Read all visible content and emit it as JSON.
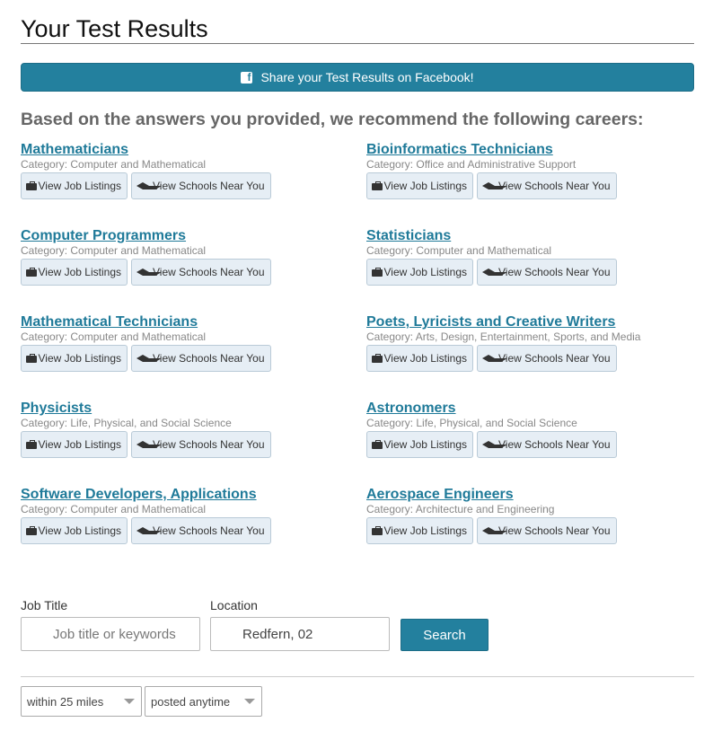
{
  "header": {
    "title": "Your Test Results",
    "share_label": "Share your Test Results on Facebook!"
  },
  "recommend_heading": "Based on the answers you provided, we recommend the following careers:",
  "buttons": {
    "jobs_label": "View Job Listings",
    "schools_label": "View Schools Near You"
  },
  "careers": [
    {
      "title": "Mathematicians",
      "category": "Category: Computer and Mathematical"
    },
    {
      "title": "Bioinformatics Technicians",
      "category": "Category: Office and Administrative Support"
    },
    {
      "title": "Computer Programmers",
      "category": "Category: Computer and Mathematical"
    },
    {
      "title": "Statisticians",
      "category": "Category: Computer and Mathematical"
    },
    {
      "title": "Mathematical Technicians",
      "category": "Category: Computer and Mathematical"
    },
    {
      "title": "Poets, Lyricists and Creative Writers",
      "category": "Category: Arts, Design, Entertainment, Sports, and Media"
    },
    {
      "title": "Physicists",
      "category": "Category: Life, Physical, and Social Science"
    },
    {
      "title": "Astronomers",
      "category": "Category: Life, Physical, and Social Science"
    },
    {
      "title": "Software Developers, Applications",
      "category": "Category: Computer and Mathematical"
    },
    {
      "title": "Aerospace Engineers",
      "category": "Category: Architecture and Engineering"
    }
  ],
  "search": {
    "job_title_label": "Job Title",
    "job_title_placeholder": "Job title or keywords",
    "location_label": "Location",
    "location_value": "Redfern, 02",
    "search_label": "Search",
    "distance_selected": "within 25 miles",
    "posted_selected": "posted anytime"
  },
  "colors": {
    "accent": "#23809e",
    "link": "#1f7a99"
  }
}
